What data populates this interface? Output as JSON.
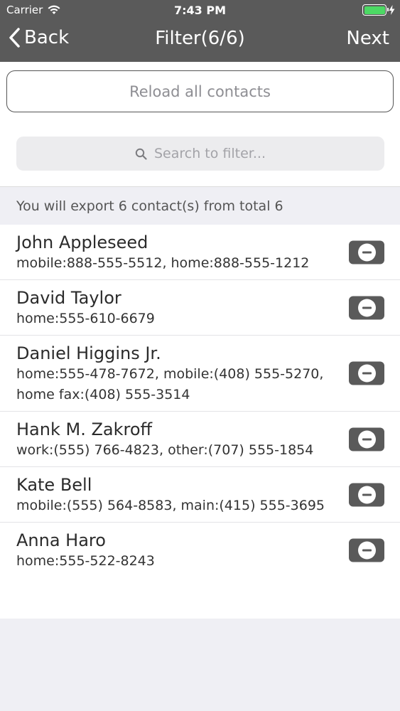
{
  "status_bar": {
    "carrier": "Carrier",
    "time": "7:43 PM",
    "battery_color": "#4cd964"
  },
  "nav": {
    "back_label": "Back",
    "title": "Filter(6/6)",
    "next_label": "Next"
  },
  "reload_button": "Reload all contacts",
  "search": {
    "placeholder": "Search to filter..."
  },
  "summary": "You will export 6 contact(s) from total 6",
  "contacts": [
    {
      "name": "John Appleseed",
      "detail": "mobile:888-555-5512, home:888-555-1212"
    },
    {
      "name": "David Taylor",
      "detail": "home:555-610-6679"
    },
    {
      "name": "Daniel Higgins Jr.",
      "detail": "home:555-478-7672, mobile:(408) 555-5270, home fax:(408) 555-3514"
    },
    {
      "name": "Hank M. Zakroff",
      "detail": "work:(555) 766-4823, other:(707) 555-1854"
    },
    {
      "name": "Kate Bell",
      "detail": "mobile:(555) 564-8583, main:(415) 555-3695"
    },
    {
      "name": "Anna Haro",
      "detail": "home:555-522-8243"
    }
  ]
}
